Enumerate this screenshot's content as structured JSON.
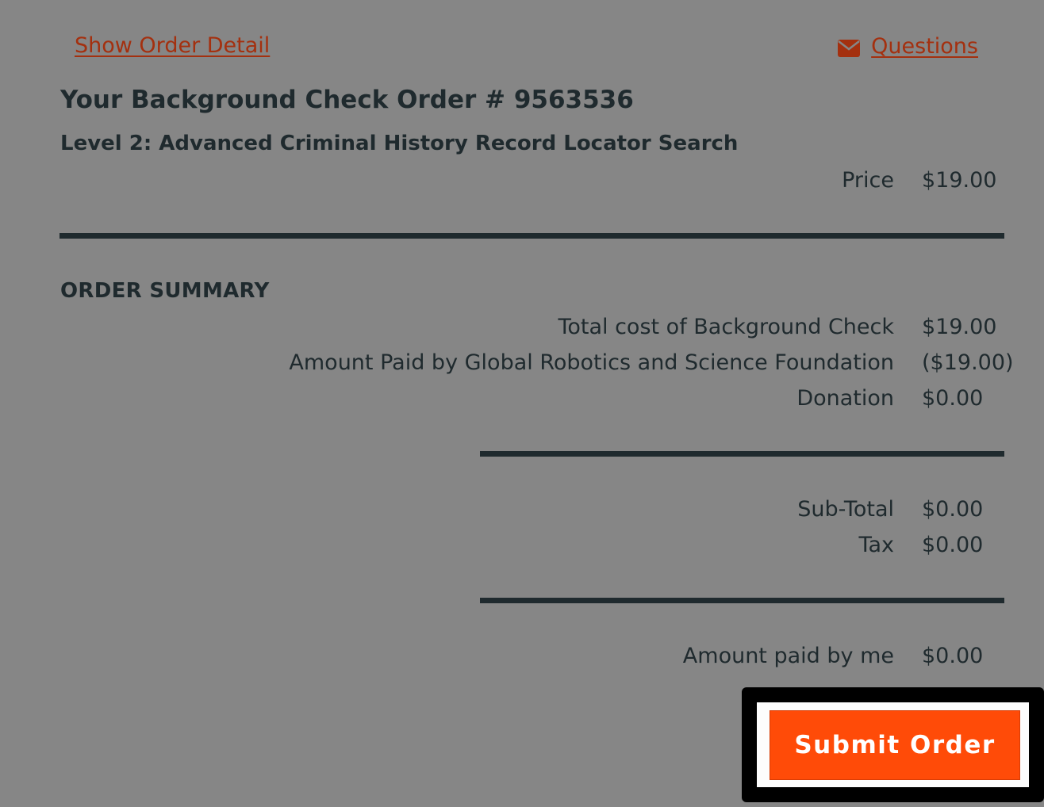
{
  "links": {
    "show_order_detail": "Show Order Detail",
    "questions": "Questions"
  },
  "order": {
    "title": "Your Background Check Order # 9563536",
    "product": "Level 2: Advanced Criminal History Record Locator Search",
    "price_label": "Price",
    "price_value": "$19.00"
  },
  "summary": {
    "heading": "ORDER SUMMARY",
    "rows": [
      {
        "label": "Total cost of Background Check",
        "value": "$19.00"
      },
      {
        "label": "Amount Paid by Global Robotics and Science Foundation",
        "value": "($19.00)"
      },
      {
        "label": "Donation",
        "value": "$0.00"
      }
    ],
    "subtotal_label": "Sub-Total",
    "subtotal_value": "$0.00",
    "tax_label": "Tax",
    "tax_value": "$0.00",
    "paid_by_me_label": "Amount paid by me",
    "paid_by_me_value": "$0.00"
  },
  "actions": {
    "submit_label": "Submit Order"
  },
  "colors": {
    "background": "#868686",
    "link": "#a4300f",
    "text": "#1f2a2e",
    "button": "#ff4b08"
  },
  "icons": {
    "questions_icon": "envelope-icon"
  }
}
